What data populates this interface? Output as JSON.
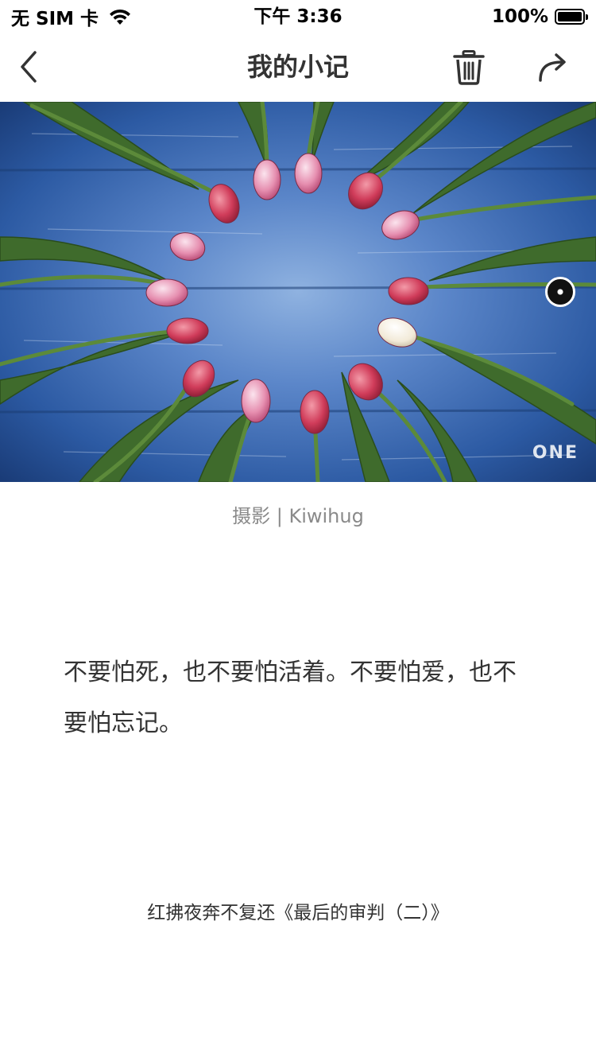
{
  "status_bar": {
    "carrier": "无 SIM 卡",
    "time": "下午 3:36",
    "battery": "100%"
  },
  "nav": {
    "title": "我的小记",
    "back_icon": "chevron-left-icon",
    "delete_icon": "trash-icon",
    "share_icon": "share-arrow-icon"
  },
  "photo": {
    "watermark": "ONE",
    "credit": "摄影 | Kiwihug"
  },
  "note": {
    "text": "不要怕死，也不要怕活着。不要怕爱，也不要怕忘记。",
    "source": "红拂夜奔不复还《最后的审判（二）》"
  },
  "colors": {
    "title": "#333333",
    "credit": "#8a8a8a",
    "background": "#ffffff"
  }
}
